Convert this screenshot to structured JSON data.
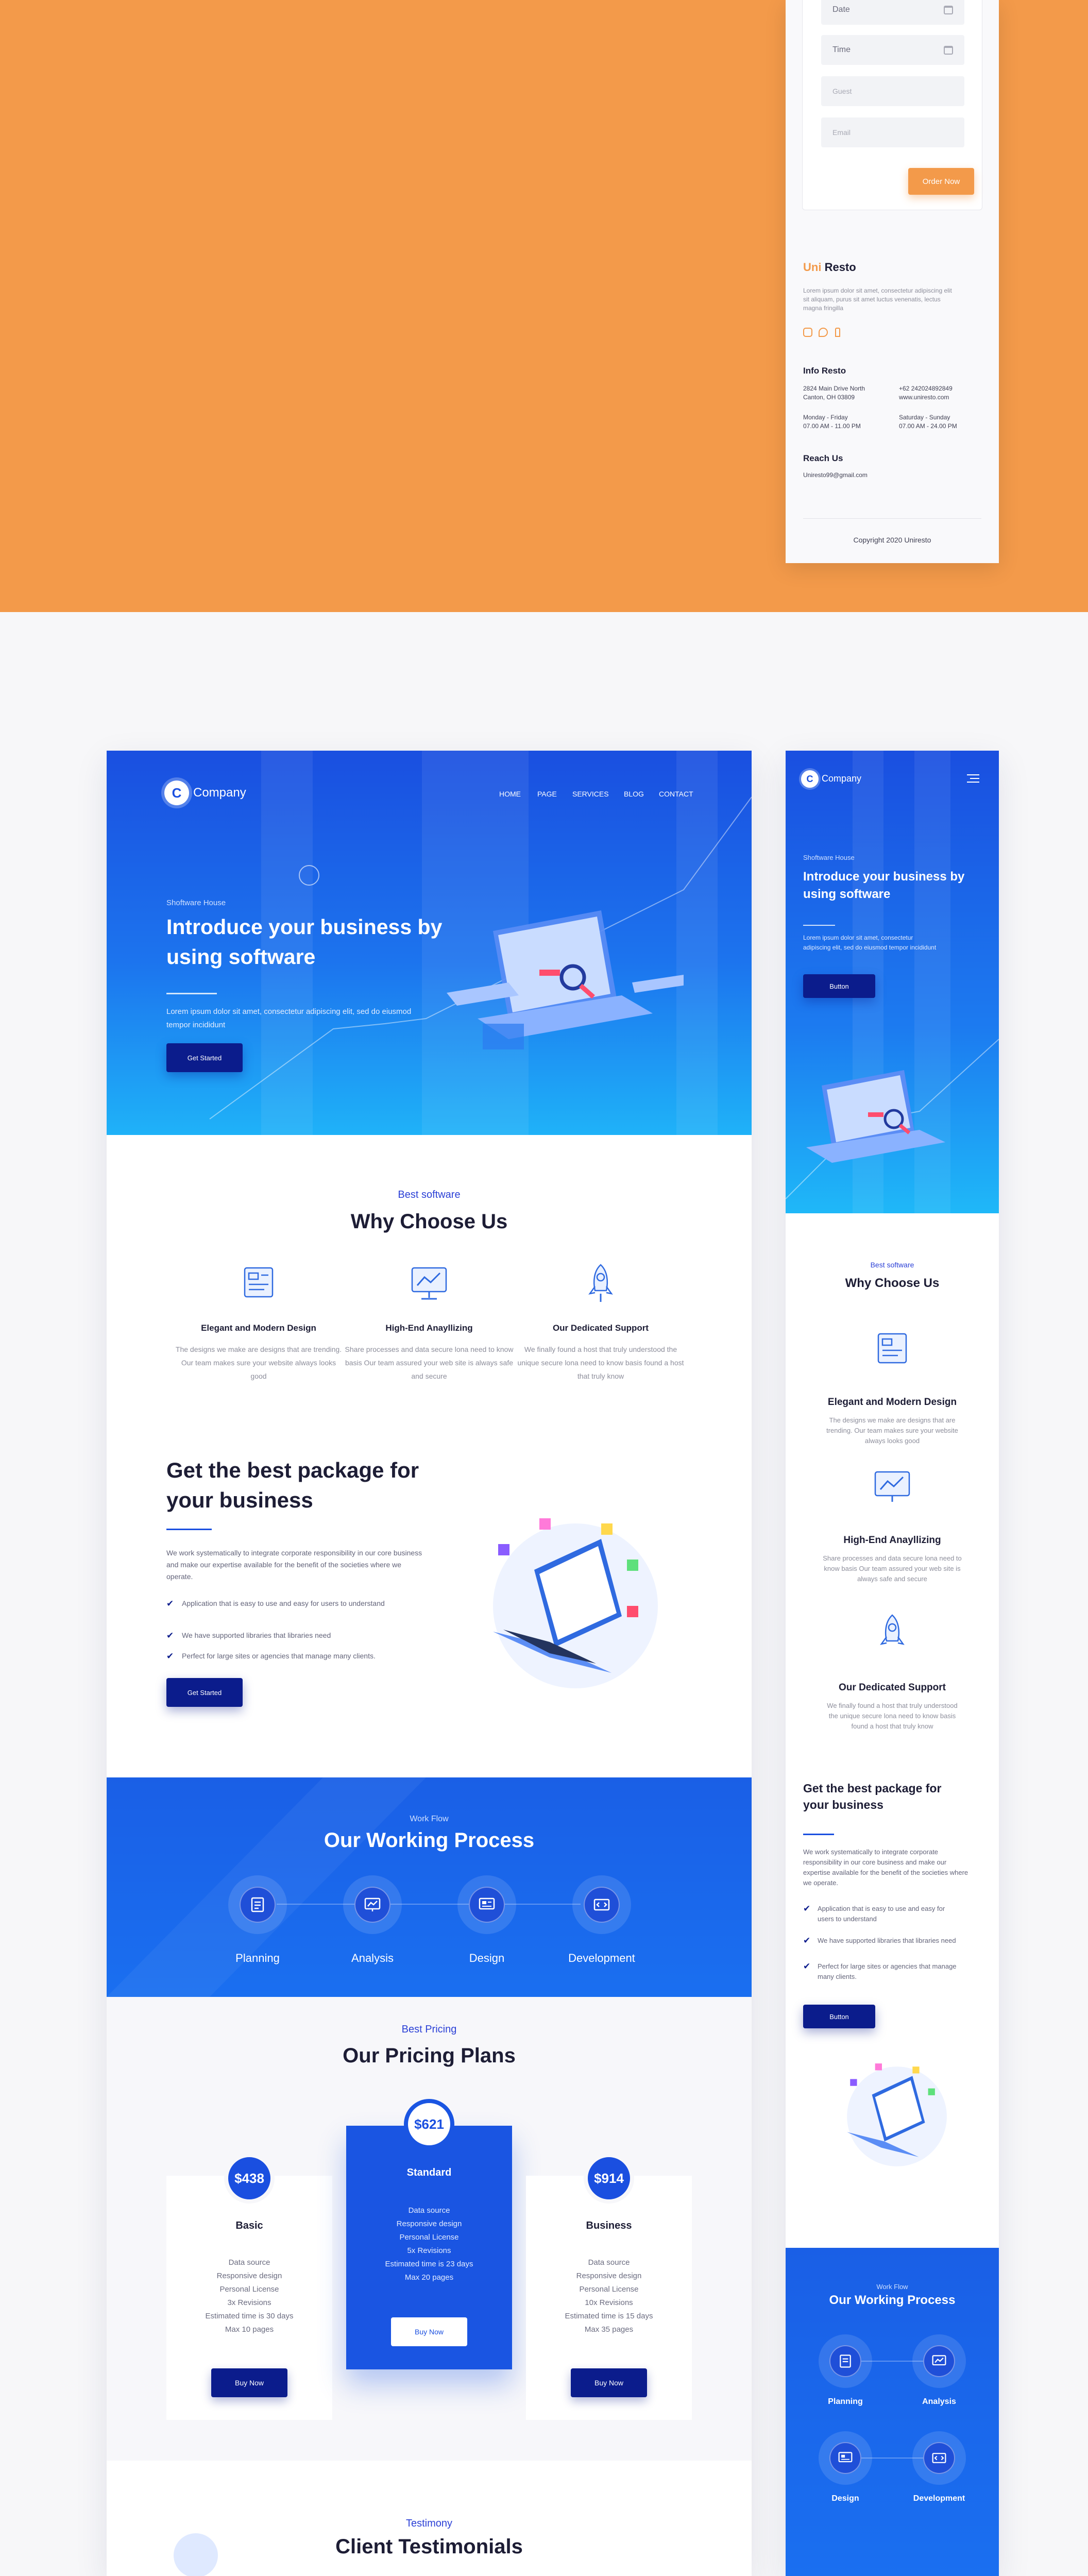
{
  "colors": {
    "orange": "#f39a4a",
    "brand_blue": "#1a4fe0",
    "dark_navy": "#0b1c8c",
    "light_bg": "#f7f7f9"
  },
  "resto": {
    "form": {
      "date_label": "Date",
      "time_label": "Time",
      "guest_placeholder": "Guest",
      "email_placeholder": "Email",
      "order_button": "Order Now"
    },
    "brand": {
      "accent": "Uni",
      "name": "Resto"
    },
    "about_text": "Lorem ipsum dolor sit amet, consectetur adipiscing elit sit aliquam, purus sit amet luctus venenatis, lectus magna fringilla",
    "social_icons": [
      "instagram-icon",
      "chat-icon",
      "facebook-icon"
    ],
    "info_heading": "Info Resto",
    "address": [
      "2824 Main Drive North",
      "Canton, OH 03809"
    ],
    "phone_web": [
      "+62 242024892849",
      "www.uniresto.com"
    ],
    "hours_weekday": [
      "Monday - Friday",
      "07.00 AM - 11.00 PM"
    ],
    "hours_weekend": [
      "Saturday - Sunday",
      "07.00 AM - 24.00 PM"
    ],
    "reach_heading": "Reach Us",
    "email": "Uniresto99@gmail.com",
    "copyright": "Copyright 2020 Uniresto"
  },
  "desktop": {
    "logo_text": "Company",
    "logo_letter": "C",
    "nav": [
      "HOME",
      "PAGE",
      "SERVICES",
      "BLOG",
      "CONTACT"
    ],
    "hero": {
      "eyebrow": "Shoftware House",
      "title": "Introduce your business by using software",
      "text": "Lorem ipsum dolor sit amet, consectetur adipiscing elit, sed do eiusmod tempor incididunt",
      "button": "Get Started"
    },
    "why": {
      "eyebrow": "Best software",
      "title": "Why Choose Us",
      "features": [
        {
          "icon": "design-board-icon",
          "title": "Elegant and Modern Design",
          "desc": "The designs we make are designs that are trending. Our team makes sure your website always looks good"
        },
        {
          "icon": "chart-monitor-icon",
          "title": "High-End Anayllizing",
          "desc": "Share processes and data secure lona need to know basis Our team assured your web site is always safe and secure"
        },
        {
          "icon": "rocket-icon",
          "title": "Our Dedicated Support",
          "desc": "We finally found a host that truly understood the unique secure lona need to know basis found a host that truly know"
        }
      ]
    },
    "package": {
      "title": "Get the best package for your business",
      "text": "We work systematically to integrate corporate responsibility in our core business and make our expertise available for the benefit of the societies where we operate.",
      "checks": [
        "Application that is easy to use and easy for users to understand",
        "We have supported libraries that libraries need",
        "Perfect for large sites or agencies that manage many clients."
      ],
      "button": "Get Started"
    },
    "process": {
      "eyebrow": "Work Flow",
      "title": "Our Working Process",
      "steps": [
        "Planning",
        "Analysis",
        "Design",
        "Development"
      ]
    },
    "pricing": {
      "eyebrow": "Best Pricing",
      "title": "Our Pricing Plans",
      "plans": [
        {
          "price": "$438",
          "name": "Basic",
          "features": [
            "Data source",
            "Responsive design",
            "Personal License",
            "3x Revisions",
            "Estimated time is 30 days",
            "Max 10 pages"
          ],
          "button": "Buy Now"
        },
        {
          "price": "$621",
          "name": "Standard",
          "features": [
            "Data source",
            "Responsive design",
            "Personal License",
            "5x Revisions",
            "Estimated time is 23 days",
            "Max 20 pages"
          ],
          "button": "Buy Now"
        },
        {
          "price": "$914",
          "name": "Business",
          "features": [
            "Data source",
            "Responsive design",
            "Personal License",
            "10x Revisions",
            "Estimated time is 15 days",
            "Max 35 pages"
          ],
          "button": "Buy Now"
        }
      ]
    },
    "testimony": {
      "eyebrow": "Testimony",
      "title": "Client Testimonials"
    }
  },
  "mobile": {
    "logo_text": "Company",
    "hero": {
      "eyebrow": "Shoftware House",
      "title": "Introduce your business by using software",
      "text": "Lorem ipsum dolor sit amet, consectetur adipiscing elit, sed do eiusmod tempor incididunt",
      "button": "Button"
    },
    "why": {
      "eyebrow": "Best software",
      "title": "Why Choose Us",
      "features": [
        {
          "title": "Elegant and Modern Design",
          "desc": "The designs we make are designs that are trending. Our team makes sure your website always looks good"
        },
        {
          "title": "High-End Anayllizing",
          "desc": "Share processes and data secure lona need to know basis Our team assured your web site is always safe and secure"
        },
        {
          "title": "Our Dedicated Support",
          "desc": "We finally found a host that truly understood the unique secure lona need to know basis found a host that truly know"
        }
      ]
    },
    "package": {
      "title": "Get the best package for your business",
      "text": "We work systematically to integrate corporate responsibility in our core business and make our expertise available for the benefit of the societies where we operate.",
      "checks": [
        "Application that is easy to use and easy for users to understand",
        "We have supported libraries that libraries need",
        "Perfect for large sites or agencies that manage many clients."
      ],
      "button": "Button"
    },
    "process": {
      "eyebrow": "Work Flow",
      "title": "Our Working Process",
      "steps": [
        "Planning",
        "Analysis",
        "Design",
        "Development"
      ]
    }
  }
}
